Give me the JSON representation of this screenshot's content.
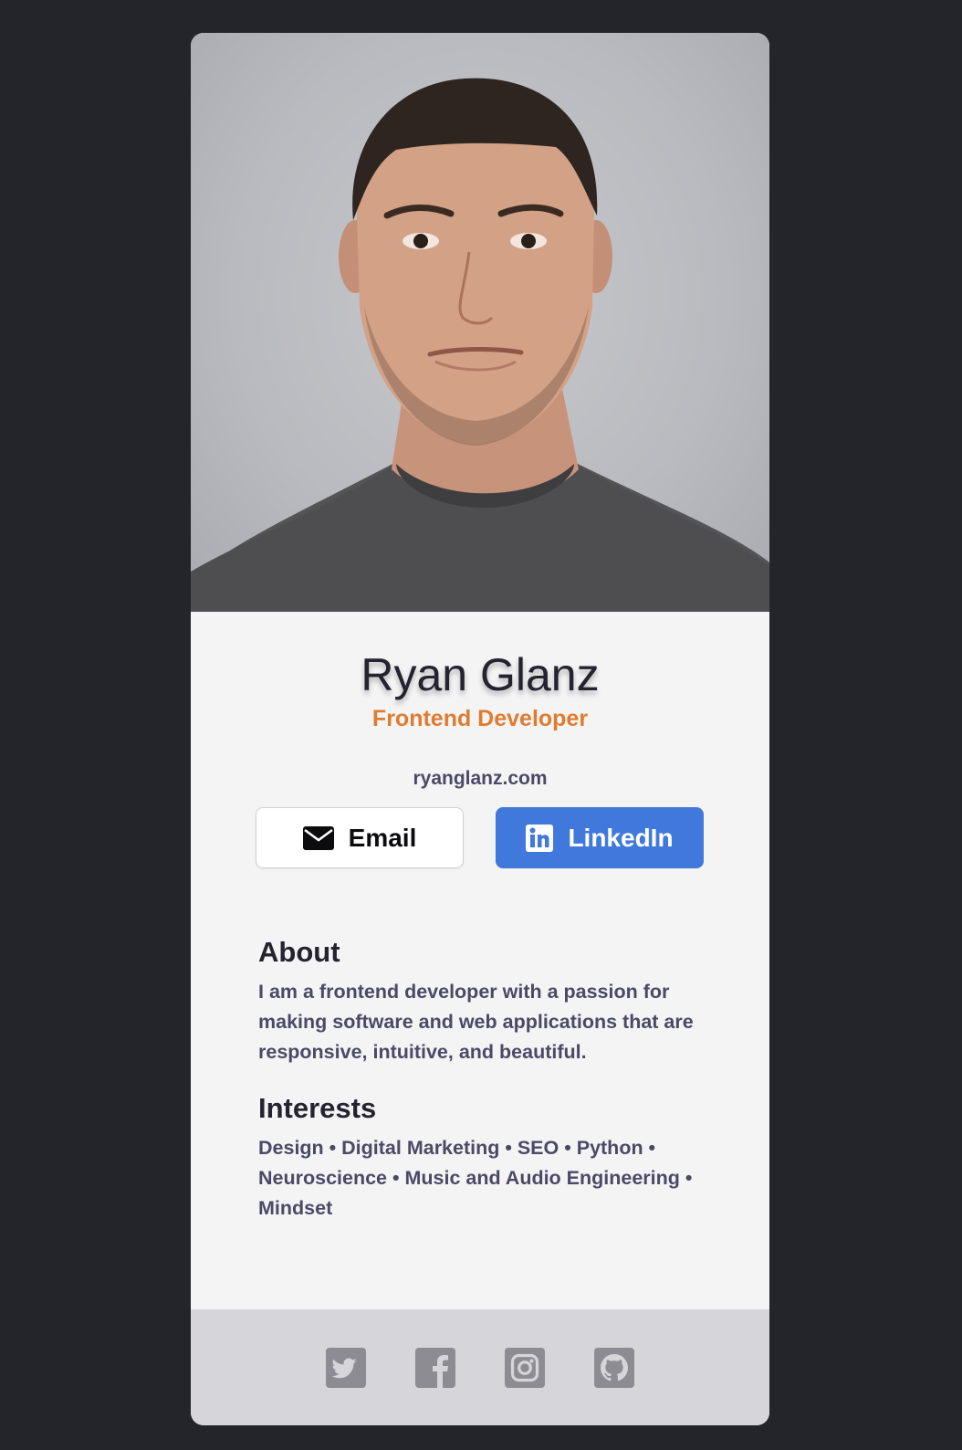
{
  "profile": {
    "name": "Ryan Glanz",
    "title": "Frontend Developer",
    "website": "ryanglanz.com"
  },
  "buttons": {
    "email_label": "Email",
    "email_icon": "envelope-icon",
    "linkedin_label": "LinkedIn",
    "linkedin_icon": "linkedin-icon"
  },
  "about": {
    "heading": "About",
    "text": "I am a frontend developer with a passion for making software and web applications that are responsive, intuitive, and beautiful."
  },
  "interests": {
    "heading": "Interests",
    "text": "Design • Digital Marketing • SEO • Python • Neuroscience • Music and Audio Engineering • Mindset"
  },
  "footer": {
    "icons": [
      "twitter-icon",
      "facebook-icon",
      "instagram-icon",
      "github-icon"
    ]
  },
  "colors": {
    "background": "#23252b",
    "card": "#f4f4f5",
    "accent_orange": "#e07c32",
    "linkedin_blue": "#4079db",
    "footer": "#d5d5da",
    "footer_icon": "#8c8c92"
  }
}
